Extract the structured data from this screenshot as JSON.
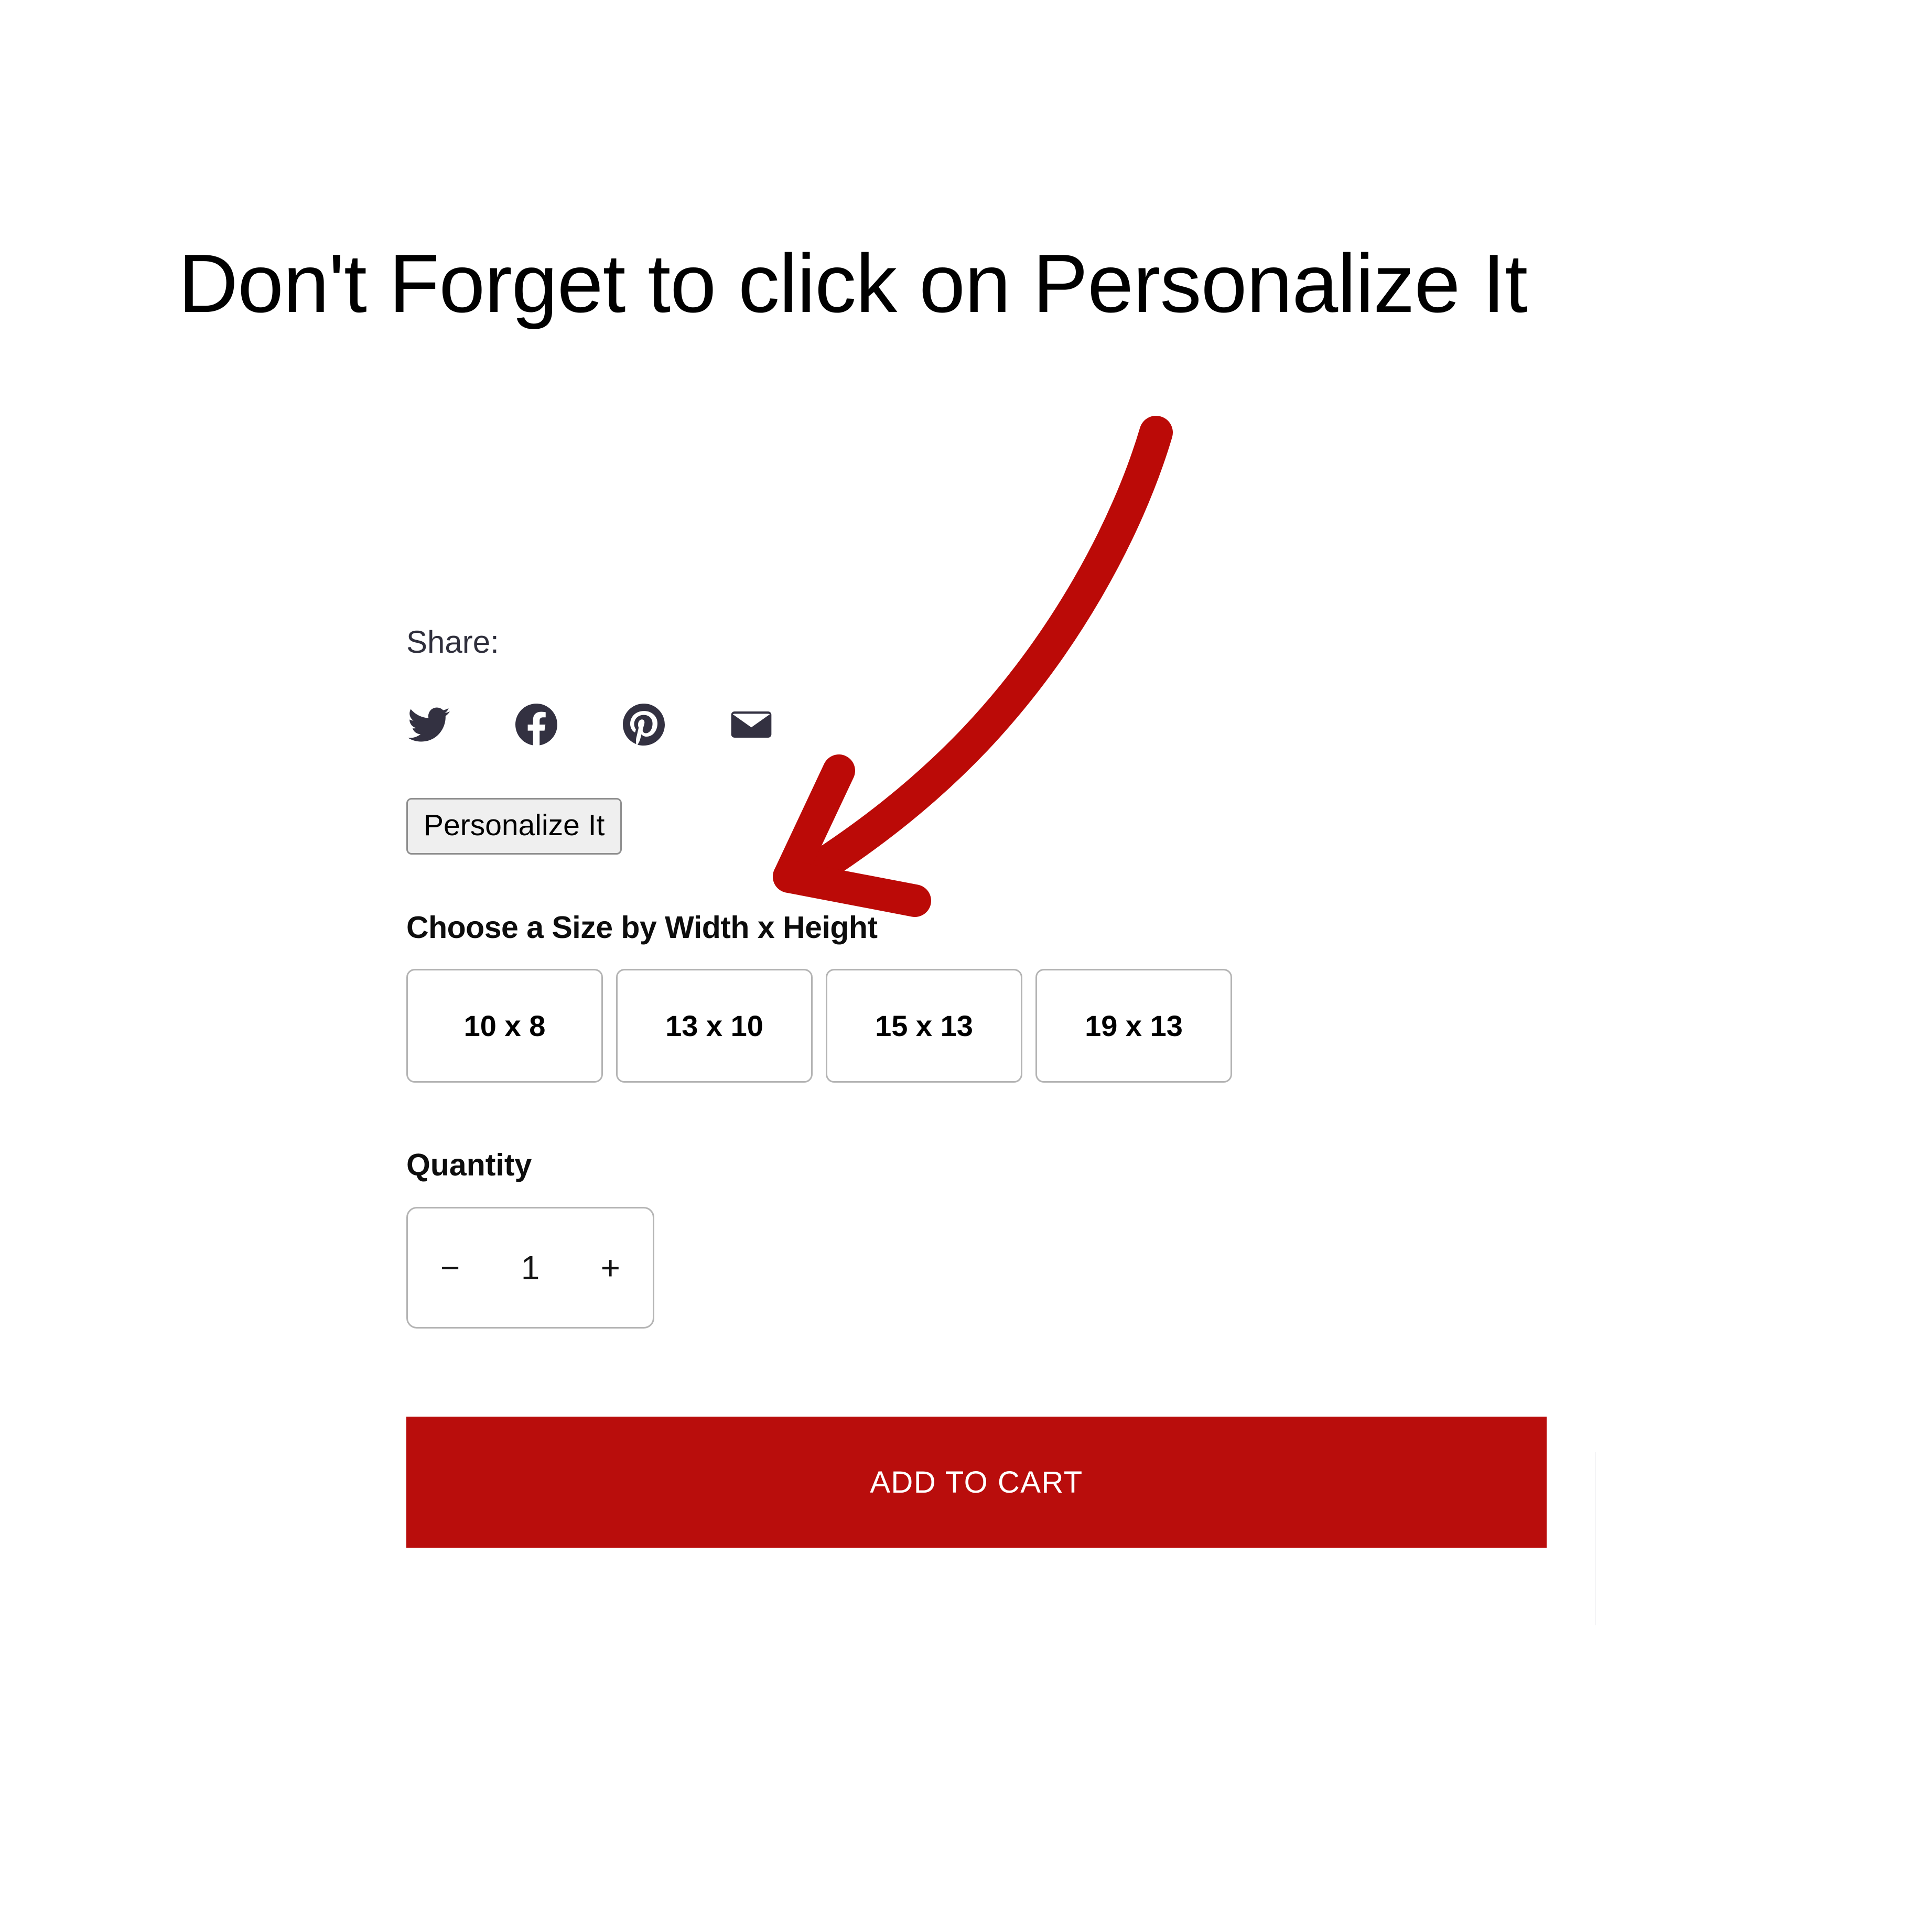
{
  "heading": {
    "text": "Don't Forget to click on Personalize It"
  },
  "annotation": {
    "arrow_color": "#bb0a07",
    "arrow_name": "curved-down-left-arrow",
    "points_to": "Personalize It"
  },
  "share": {
    "label": "Share:",
    "icons": [
      {
        "name": "twitter-icon",
        "label": "Twitter"
      },
      {
        "name": "facebook-icon",
        "label": "Facebook"
      },
      {
        "name": "pinterest-icon",
        "label": "Pinterest"
      },
      {
        "name": "email-icon",
        "label": "Email"
      }
    ],
    "icon_color": "#333141"
  },
  "personalize": {
    "label": "Personalize It",
    "background": "#efefef",
    "border_color": "#8f8f8f"
  },
  "size": {
    "heading": "Choose a Size by Width x Height",
    "options": [
      {
        "label": "10 x 8"
      },
      {
        "label": "13 x 10"
      },
      {
        "label": "15 x 13"
      },
      {
        "label": "19 x 13"
      }
    ],
    "border_color": "#b4b4b4"
  },
  "quantity": {
    "heading": "Quantity",
    "decrement_label": "−",
    "value": "1",
    "increment_label": "+"
  },
  "cart": {
    "label": "ADD TO CART",
    "background": "#b90d0c",
    "text_color": "#ffffff"
  }
}
